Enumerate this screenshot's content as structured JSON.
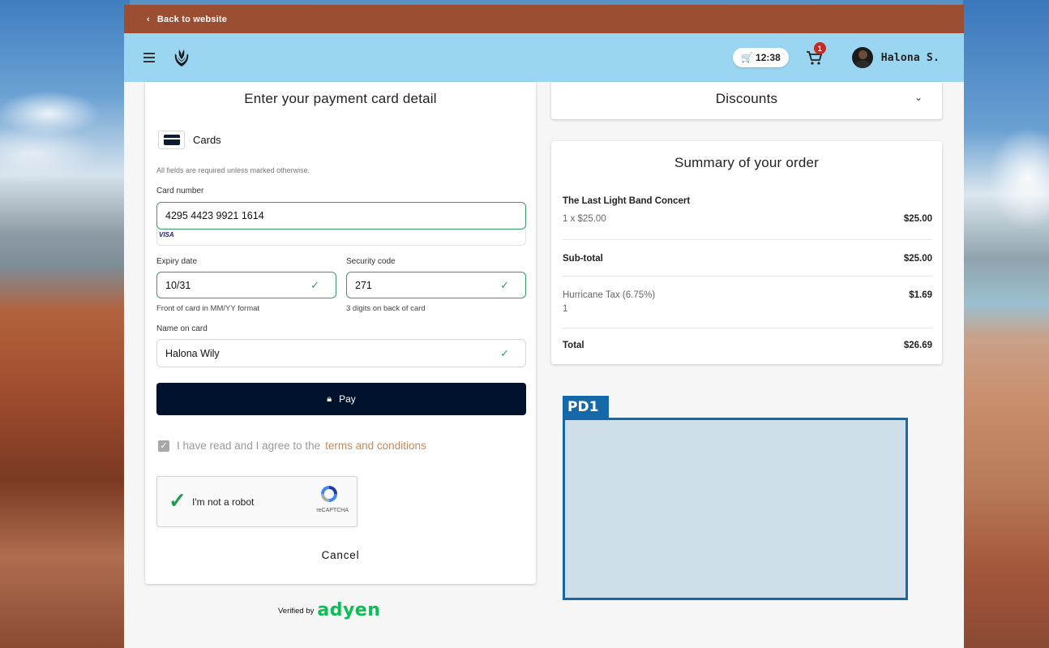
{
  "topbar": {
    "back_label": "Back to website"
  },
  "header": {
    "timer": "12:38",
    "cart_count": "1",
    "username": "Halona S."
  },
  "payment": {
    "title": "Enter your payment card detail",
    "method_label": "Cards",
    "required_note": "All fields are required unless marked otherwise.",
    "card_number_label": "Card number",
    "card_number_value": "4295 4423 9921 1614",
    "card_brand": "VISA",
    "expiry_label": "Expiry date",
    "expiry_value": "10/31",
    "expiry_hint": "Front of card in MM/YY format",
    "security_label": "Security code",
    "security_value": "271",
    "security_hint": "3 digits on back of card",
    "name_label": "Name on card",
    "name_value": "Halona Wily",
    "pay_label": "Pay",
    "terms_prefix": "I have read and I agree to the",
    "terms_link": "terms and conditions",
    "captcha_label": "I'm not a robot",
    "captcha_brand": "reCAPTCHA",
    "cancel_label": "Cancel"
  },
  "verified": {
    "prefix": "Verified by",
    "brand": "adyen"
  },
  "discounts": {
    "title": "Discounts"
  },
  "summary": {
    "title": "Summary of your order",
    "item_name": "The Last Light Band Concert",
    "item_qty_price": "1 x $25.00",
    "item_total": "$25.00",
    "subtotal_label": "Sub-total",
    "subtotal_value": "$25.00",
    "tax_label": "Hurricane Tax (6.75%)",
    "tax_qty": "1",
    "tax_value": "$1.69",
    "total_label": "Total",
    "total_value": "$26.69"
  },
  "placeholder": {
    "label": "PD1"
  },
  "colors": {
    "topbar": "#9c4e32",
    "header": "#9ad6f1",
    "pay_button": "#00112c",
    "valid": "#2e9e5b",
    "terms_link": "#c48a5a",
    "adyen": "#0abf53",
    "placeholder": "#1569a8"
  }
}
